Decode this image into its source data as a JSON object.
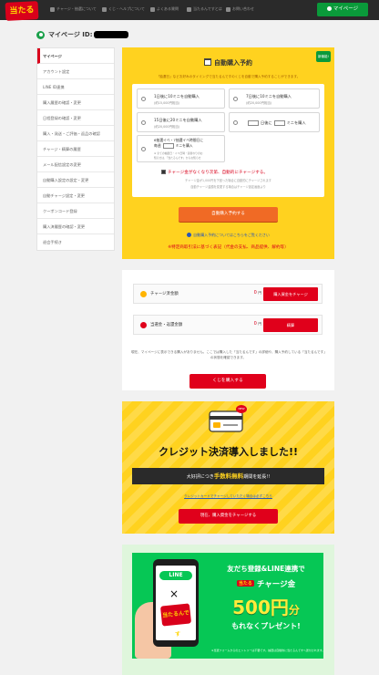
{
  "header": {
    "logo_text": "当たる",
    "nav": [
      {
        "label": "チャージ・抽選について"
      },
      {
        "label": "くじ・ヘルプについて"
      },
      {
        "label": "よくある質問"
      },
      {
        "label": "当たるんですとは"
      },
      {
        "label": "お問い合わせ"
      }
    ],
    "mypage_button": "マイページ"
  },
  "page": {
    "title": "マイページ ID:"
  },
  "sidebar": {
    "items": [
      {
        "label": "マイページ"
      },
      {
        "label": "アカウント設定"
      },
      {
        "label": "LINE ID連携"
      },
      {
        "label": "購入履歴の確認・変更"
      },
      {
        "label": "日程登録の確認・変更"
      },
      {
        "label": "購入・発送・ご評価・返品の確認"
      },
      {
        "label": "チャージ・精算の履歴"
      },
      {
        "label": "メール配信設定の変更"
      },
      {
        "label": "自動購入設定の設定・変更"
      },
      {
        "label": "自動チャージ設定・変更"
      },
      {
        "label": "クーポンコード登録"
      },
      {
        "label": "購入済履歴の確認・変更"
      },
      {
        "label": "退会手続き"
      }
    ]
  },
  "auto_purchase": {
    "badge": "新機能!",
    "title": "自動購入予約",
    "description": "「抽選日」などお好みのタイミングで当たるんですのくじを自動で購入予約することができます。",
    "options": [
      {
        "line1": "1日後に10ミニを自動購入",
        "line2": "(約15,000円相当)"
      },
      {
        "line1": "7日後に10ミニを自動購入",
        "line2": "(約20,000円相当)"
      },
      {
        "line1": "15日後に20ミニを自動購入",
        "line2": "(約20,000円相当)"
      },
      {
        "line1": "日後に",
        "line2": "",
        "suffix": "ミニを購入"
      },
      {
        "line1": "6抽選イベ・7抽選イベ時間日に",
        "line1b": "毎週",
        "suffix": "ミニを購入",
        "line2": "※ 全ての抽選日・イベ日時・週替わりのお",
        "line3": "知らせは、「当たるんです」からお知らせ"
      }
    ],
    "charge_check": "チャージ金がなくなり次第、自動的にチャージする。",
    "charge_sub1": "チャージ金が1,000円を下回った場合に自動的にチャージされます",
    "charge_sub2": "自動チャージ金額を変更する場合はチャージ設定画面より",
    "submit_button": "自動購入予約する",
    "how_link": "自動購入予約についてはこちらをご覧ください",
    "law_link": "※特定商取引法に基づく表記（代金の支払、商品提供、解約等）"
  },
  "balance": {
    "rows": [
      {
        "label": "チャージ済金額",
        "value": "0",
        "unit": "円",
        "button": "購入資金をチャージ",
        "icon_color": "#ffb400"
      },
      {
        "label": "当選金・返還金額",
        "value": "0",
        "unit": "円",
        "button": "精算",
        "icon_color": "#e0001b"
      }
    ],
    "note": "現在、マイページに表示できる購入がありません。ここでは購入した「当たるんです」の詳細や、購入予約している「当たるんです」の状態を確認できます。",
    "kuji_button": "くじを購入する"
  },
  "credit_banner": {
    "new_badge": "NEW",
    "headline": "クレジット決済導入しました!!",
    "band_prefix": "大好評につき",
    "band_highlight": "手数料無料",
    "band_suffix": "期間を延長!!",
    "link": "クレジットカードでチャージしていただく場合は必ずこちら",
    "button": "現在、購入資金をチャージする"
  },
  "line_banner": {
    "line_logo": "LINE",
    "cross": "×",
    "brand": "当たるんです",
    "text1": "友だち登録&LINE連携で",
    "tag": "当たる",
    "text2": "チャージ金",
    "amount": "500円",
    "amount_suffix": "分",
    "text3": "もれなくプレゼント!",
    "footnote": "※当選フォームからのエントリーは不要です。抽選は自動的に当たるんですへ送付されます。"
  },
  "colors": {
    "brand_red": "#e0001b",
    "brand_yellow": "#ffd21f",
    "brand_green": "#0a9a3a",
    "line_green": "#06c755",
    "orange": "#f06a25"
  }
}
